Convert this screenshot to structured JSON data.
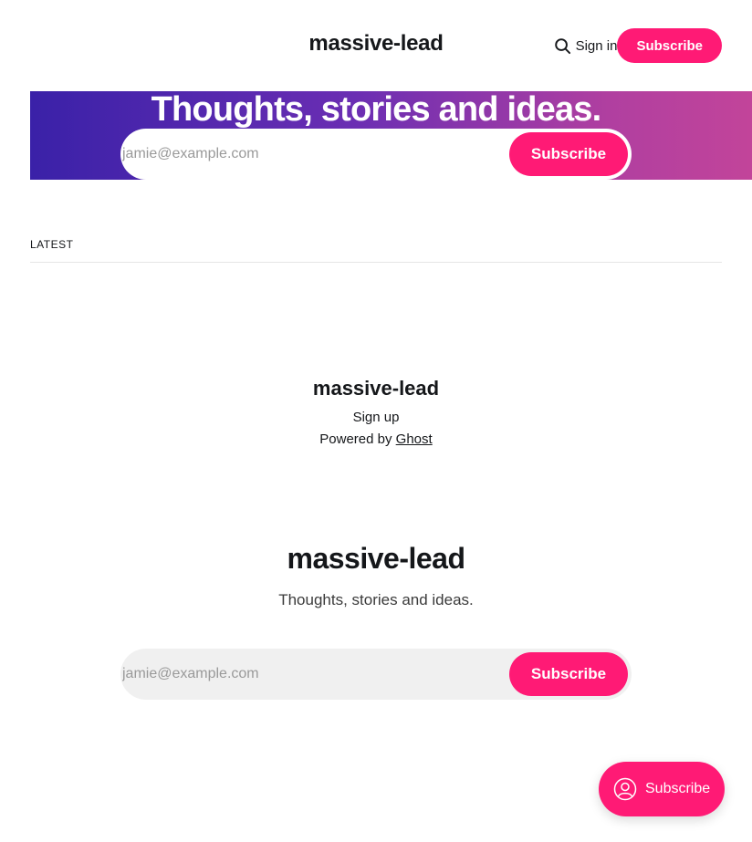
{
  "header": {
    "brand": "massive-lead",
    "search_icon": "search-icon",
    "signin_label": "Sign in",
    "subscribe_label": "Subscribe"
  },
  "hero": {
    "title": "Thoughts, stories and ideas.",
    "email_placeholder": "jamie@example.com",
    "subscribe_label": "Subscribe"
  },
  "latest": {
    "label": "LATEST"
  },
  "footer": {
    "brand": "massive-lead",
    "signup": "Sign up",
    "powered_prefix": "Powered by",
    "powered_link": "Ghost"
  },
  "cta": {
    "brand": "massive-lead",
    "description": "Thoughts, stories and ideas.",
    "email_placeholder": "jamie@example.com",
    "subscribe_label": "Subscribe"
  },
  "portal": {
    "icon": "user-circle-icon",
    "label": "Subscribe"
  },
  "colors": {
    "accent": "#ff1a75",
    "hero_gradient_start": "#3a21a8",
    "hero_gradient_end": "#c2449a"
  }
}
